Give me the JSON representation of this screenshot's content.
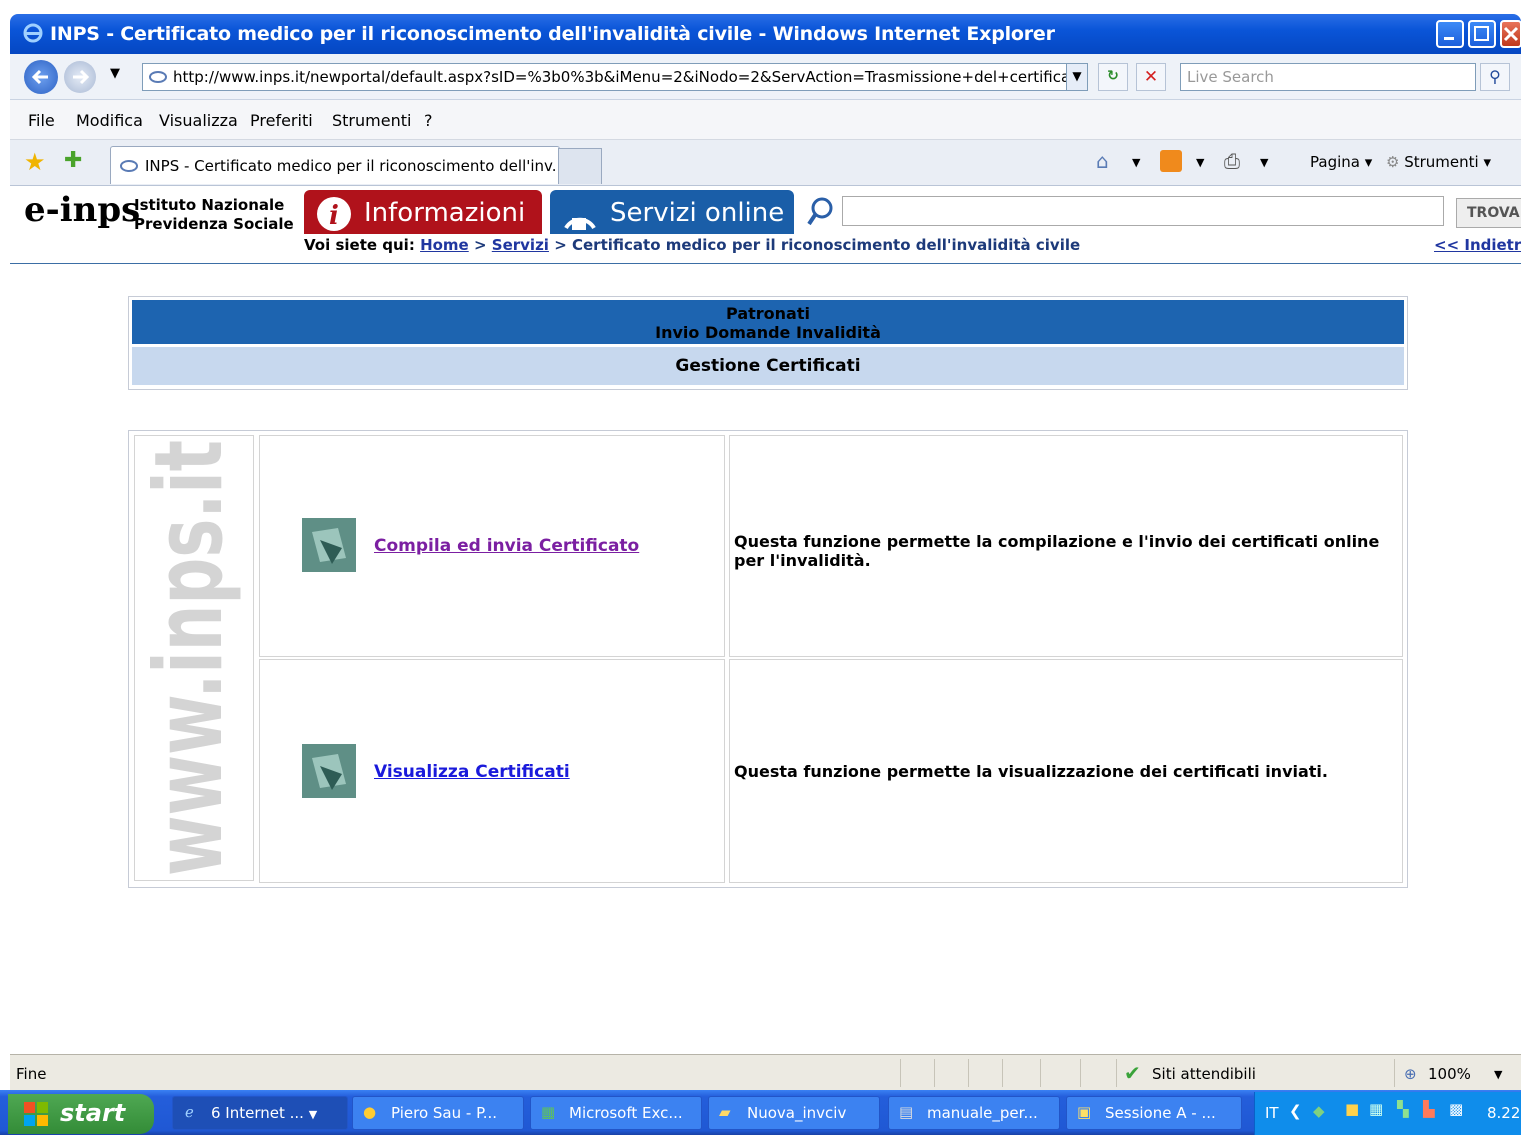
{
  "window": {
    "title": "INPS - Certificato medico per il riconoscimento dell'invalidità civile - Windows Internet Explorer"
  },
  "addressbar": {
    "url": "http://www.inps.it/newportal/default.aspx?sID=%3b0%3b&iMenu=2&iNodo=2&ServAction=Trasmissione+del+certificato",
    "search_placeholder": "Live Search"
  },
  "menu": [
    "File",
    "Modifica",
    "Visualizza",
    "Preferiti",
    "Strumenti",
    "?"
  ],
  "tabs": {
    "active_tab": "INPS - Certificato medico per il riconoscimento dell'inv...",
    "commands": [
      "Pagina",
      "Strumenti"
    ]
  },
  "site_header": {
    "logo": "e-inps",
    "org_line1": "Istituto Nazionale",
    "org_line2": "Previdenza Sociale",
    "btn_info": "Informazioni",
    "btn_servizi": "Servizi online",
    "search_button": "TROVA",
    "crumb_prefix": "Voi siete qui:",
    "crumb_home": "Home",
    "crumb_servizi": "Servizi",
    "crumb_current": "Certificato medico per il riconoscimento dell'invalidità civile",
    "back": "<< Indietro"
  },
  "content": {
    "header_line1": "Patronati",
    "header_line2": "Invio Domande Invalidità",
    "subheader": "Gestione Certificati",
    "watermark": "www.inps.it",
    "rows": [
      {
        "link": "Compila ed invia Certificato",
        "link_color": "#7b1fa2",
        "description": "Questa funzione permette la compilazione e l'invio dei certificati online per l'invalidità."
      },
      {
        "link": "Visualizza Certificati",
        "link_color": "#1a1adb",
        "description": "Questa funzione permette la visualizzazione dei certificati inviati."
      }
    ]
  },
  "statusbar": {
    "left": "Fine",
    "zone": "Siti attendibili",
    "zoom": "100%"
  },
  "taskbar": {
    "start": "start",
    "items": [
      "6 Internet ...",
      "Piero Sau - P...",
      "Microsoft Exc...",
      "Nuova_invciv",
      "manuale_per...",
      "Sessione A - ..."
    ],
    "lang": "IT",
    "clock": "8.22"
  },
  "colors": {
    "titlebar": "#0a55d8",
    "header_blue": "#1d64b0",
    "header_light": "#c7d8ee",
    "info_red": "#b0121b",
    "servizi_blue": "#1a5ea8"
  }
}
